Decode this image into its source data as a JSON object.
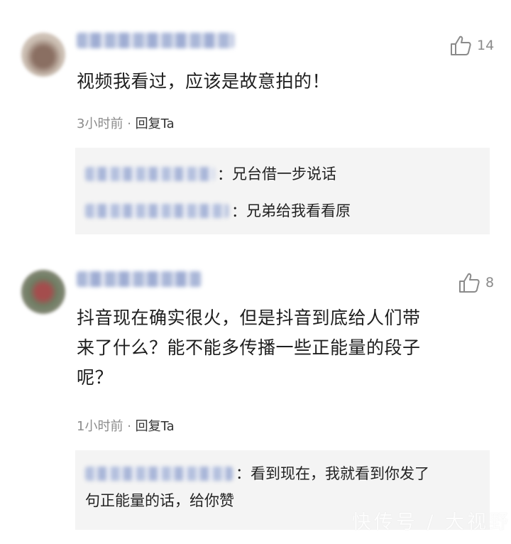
{
  "comments": [
    {
      "like_count": "14",
      "text": "视频我看过，应该是故意拍的！",
      "time": "3小时前",
      "separator": "·",
      "reply_label": "回复Ta",
      "replies": [
        {
          "sep": "：",
          "text": "兄台借一步说话"
        },
        {
          "sep": "：",
          "text": "兄弟给我看看原"
        }
      ]
    },
    {
      "like_count": "8",
      "text_lines": [
        "抖音现在确实很火，但是抖音到底给人们带",
        "来了什么？能不能多传播一些正能量的段子",
        "呢？"
      ],
      "time": "1小时前",
      "separator": "·",
      "reply_label": "回复Ta",
      "replies": [
        {
          "sep": "：",
          "text_lines": [
            "看到现在，我就看到你发了",
            "句正能量的话，给你赞"
          ]
        }
      ]
    }
  ],
  "watermark": "快传号 / 大视野",
  "icons": {
    "like": "thumbs-up-icon"
  },
  "colors": {
    "reply_bg": "#f4f4f4",
    "meta": "#8c8c8c",
    "like": "#8a8a8a"
  }
}
